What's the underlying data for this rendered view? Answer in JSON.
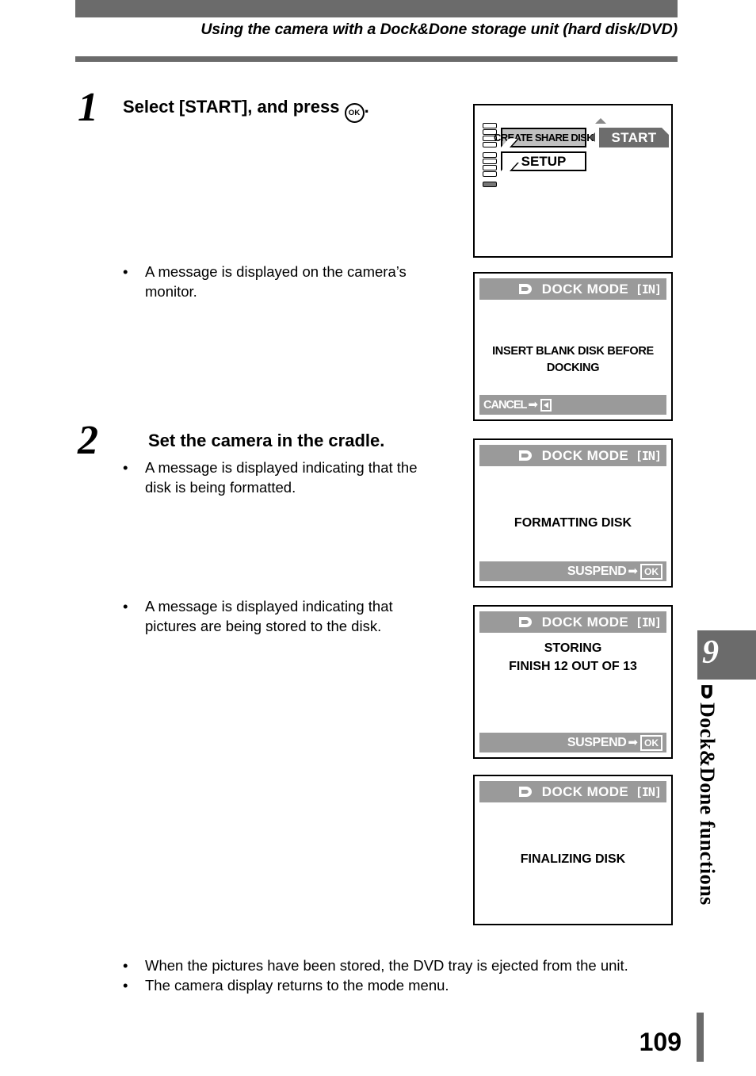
{
  "header": {
    "title": "Using the camera with a Dock&Done storage unit (hard disk/DVD)"
  },
  "steps": [
    {
      "number": "1",
      "heading_before_icon": "Select [START], and press",
      "icon": "ok-button-icon",
      "icon_label": "OK",
      "heading_after_icon": ".",
      "bullets": [
        "A message is displayed on the camera’s monitor."
      ]
    },
    {
      "number": "2",
      "heading": "Set the camera in the cradle.",
      "bullets": [
        "A message is displayed indicating that the disk is being formatted.",
        "A message is displayed indicating that pictures are being stored to the disk."
      ]
    }
  ],
  "bullet_char": "•",
  "screens": {
    "mode_menu": {
      "name": "camera-mode-menu",
      "items": [
        {
          "label": "CREATE SHARE DISK",
          "selected": true
        },
        {
          "label": "SETUP",
          "selected": false
        }
      ],
      "submenu": {
        "label": "START",
        "highlighted": true
      },
      "scroll_segments": 9,
      "scroll_active_index": 8
    },
    "insert_disk": {
      "title": "DOCK MODE",
      "status": "[IN]",
      "message": "INSERT BLANK DISK BEFORE DOCKING",
      "footer_label": "CANCEL",
      "footer_arrow": "➡",
      "footer_key": "arrow-left"
    },
    "formatting": {
      "title": "DOCK MODE",
      "status": "[IN]",
      "message": "FORMATTING DISK",
      "footer_label": "SUSPEND",
      "footer_arrow": "➡",
      "footer_key": "OK"
    },
    "storing": {
      "title": "DOCK MODE",
      "status": "[IN]",
      "message_line1": "STORING",
      "message_line2": "FINISH 12 OUT OF 13",
      "footer_label": "SUSPEND",
      "footer_arrow": "➡",
      "footer_key": "OK"
    },
    "finalizing": {
      "title": "DOCK MODE",
      "status": "[IN]",
      "message": "FINALIZING DISK"
    }
  },
  "closing_bullets": [
    "When the pictures have been stored, the DVD tray is ejected from the unit.",
    "The camera display returns to the mode menu."
  ],
  "chapter_tab": {
    "number": "9",
    "label": "Dock&Done functions"
  },
  "footer": {
    "page_number": "109"
  },
  "colors": {
    "rule_gray": "#6b6b6b",
    "screen_bar_gray": "#9a9a9a",
    "menu_selected_gray": "#c0c0c0",
    "menu_highlight_gray": "#6d6d6d"
  }
}
